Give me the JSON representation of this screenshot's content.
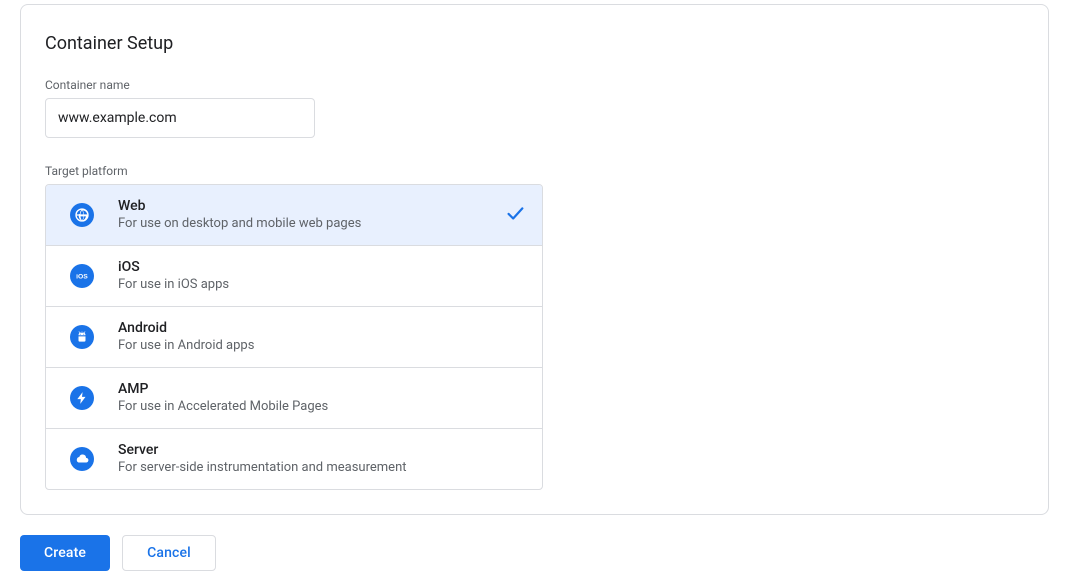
{
  "header": {
    "title": "Container Setup"
  },
  "form": {
    "container_name_label": "Container name",
    "container_name_value": "www.example.com",
    "target_platform_label": "Target platform"
  },
  "platforms": [
    {
      "icon": "globe-icon",
      "title": "Web",
      "desc": "For use on desktop and mobile web pages",
      "selected": true
    },
    {
      "icon": "ios-icon",
      "title": "iOS",
      "desc": "For use in iOS apps",
      "selected": false
    },
    {
      "icon": "android-icon",
      "title": "Android",
      "desc": "For use in Android apps",
      "selected": false
    },
    {
      "icon": "amp-icon",
      "title": "AMP",
      "desc": "For use in Accelerated Mobile Pages",
      "selected": false
    },
    {
      "icon": "server-icon",
      "title": "Server",
      "desc": "For server-side instrumentation and measurement",
      "selected": false
    }
  ],
  "buttons": {
    "create_label": "Create",
    "cancel_label": "Cancel"
  }
}
